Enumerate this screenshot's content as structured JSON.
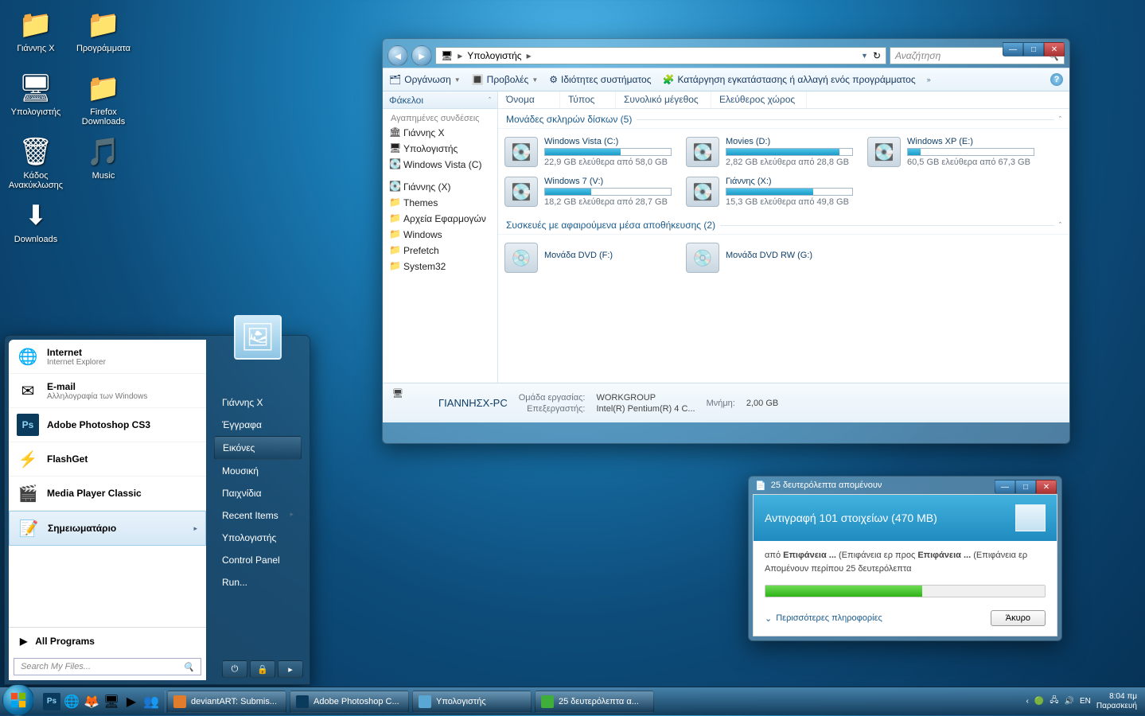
{
  "desktop": {
    "col1": [
      {
        "label": "Γιάννης X",
        "icon": "📁"
      },
      {
        "label": "Υπολογιστής",
        "icon": "🖥"
      },
      {
        "label": "Κάδος Ανακύκλωσης",
        "icon": "🗑"
      },
      {
        "label": "Downloads",
        "icon": "⬇"
      }
    ],
    "col2": [
      {
        "label": "Προγράμματα",
        "icon": "📁"
      },
      {
        "label": "Firefox Downloads",
        "icon": "📁"
      },
      {
        "label": "Music",
        "icon": "🎵"
      }
    ]
  },
  "explorer": {
    "breadcrumb": [
      "Υπολογιστής"
    ],
    "search_placeholder": "Αναζήτηση",
    "toolbar": {
      "organize": "Οργάνωση",
      "views": "Προβολές",
      "sysprops": "Ιδιότητες συστήματος",
      "uninstall": "Κατάργηση εγκατάστασης ή αλλαγή ενός προγράμματος"
    },
    "folders_header": "Φάκελοι",
    "favorites_header": "Αγαπημένες συνδέσεις",
    "favorites": [
      {
        "label": "Γιάννης X",
        "icon": "🏛"
      },
      {
        "label": "Υπολογιστής",
        "icon": "🖥"
      },
      {
        "label": "Windows Vista (C)",
        "icon": "💽"
      }
    ],
    "folders": [
      {
        "label": "Γιάννης (X)",
        "icon": "💽"
      },
      {
        "label": "Themes",
        "icon": "📁"
      },
      {
        "label": "Αρχεία Εφαρμογών",
        "icon": "📁"
      },
      {
        "label": "Windows",
        "icon": "📁"
      },
      {
        "label": "Prefetch",
        "icon": "📁"
      },
      {
        "label": "System32",
        "icon": "📁"
      }
    ],
    "columns": [
      "Όνομα",
      "Τύπος",
      "Συνολικό μέγεθος",
      "Ελεύθερος χώρος"
    ],
    "group1": "Μονάδες σκληρών δίσκων (5)",
    "drives": [
      {
        "name": "Windows Vista (C:)",
        "free": "22,9 GB ελεύθερα από 58,0 GB",
        "pct": 60
      },
      {
        "name": "Movies (D:)",
        "free": "2,82 GB ελεύθερα από 28,8 GB",
        "pct": 90
      },
      {
        "name": "Windows XP (E:)",
        "free": "60,5 GB ελεύθερα από 67,3 GB",
        "pct": 10
      },
      {
        "name": "Windows 7 (V:)",
        "free": "18,2 GB ελεύθερα από 28,7 GB",
        "pct": 37
      },
      {
        "name": "Γιάννης (X:)",
        "free": "15,3 GB ελεύθερα από 49,8 GB",
        "pct": 69
      }
    ],
    "group2": "Συσκευές με αφαιρούμενα μέσα αποθήκευσης (2)",
    "removable": [
      {
        "name": "Μονάδα DVD (F:)"
      },
      {
        "name": "Μονάδα DVD RW (G:)"
      }
    ],
    "details": {
      "computer_name": "ΓΙΑΝΝΗΣΧ-PC",
      "workgroup_label": "Ομάδα εργασίας:",
      "workgroup": "WORKGROUP",
      "cpu_label": "Επεξεργαστής:",
      "cpu": "Intel(R) Pentium(R) 4 C...",
      "mem_label": "Μνήμη:",
      "mem": "2,00 GB"
    }
  },
  "startmenu": {
    "left": [
      {
        "title": "Internet",
        "sub": "Internet Explorer",
        "icon": "🌐"
      },
      {
        "title": "E-mail",
        "sub": "Αλληλογραφία των Windows",
        "icon": "✉"
      },
      {
        "title": "Adobe Photoshop CS3",
        "sub": "",
        "icon": "Ps"
      },
      {
        "title": "FlashGet",
        "sub": "",
        "icon": "⚡"
      },
      {
        "title": "Media Player Classic",
        "sub": "",
        "icon": "🎬"
      },
      {
        "title": "Σημειωματάριο",
        "sub": "",
        "icon": "📝",
        "selected": true
      }
    ],
    "all_programs": "All Programs",
    "search_placeholder": "Search My Files...",
    "right": [
      "Γιάννης X",
      "Έγγραφα",
      "Εικόνες",
      "Μουσική",
      "Παιχνίδια",
      "Recent Items",
      "Υπολογιστής",
      "Control Panel",
      "Run..."
    ],
    "right_selected_index": 2
  },
  "copydlg": {
    "title": "25 δευτερόλεπτα απομένουν",
    "heading": "Αντιγραφή 101 στοιχείων (470 MB)",
    "line1_from": "από ",
    "line1_src": "Επιφάνεια ...",
    "line1_mid": " (Επιφάνεια ερ προς ",
    "line1_dst": "Επιφάνεια ...",
    "line1_end": " (Επιφάνεια ερ",
    "line2": "Απομένουν περίπου 25 δευτερόλεπτα",
    "more": "Περισσότερες πληροφορίες",
    "cancel": "Άκυρο"
  },
  "taskbar": {
    "buttons": [
      {
        "label": "deviantART: Submis...",
        "color": "#e07c2c"
      },
      {
        "label": "Adobe Photoshop C...",
        "color": "#0a3a5c"
      },
      {
        "label": "Υπολογιστής",
        "color": "#5aa7d4"
      },
      {
        "label": "25 δευτερόλεπτα α...",
        "color": "#3fae3a"
      }
    ],
    "lang": "EN",
    "time": "8:04 πμ",
    "day": "Παρασκευή"
  }
}
